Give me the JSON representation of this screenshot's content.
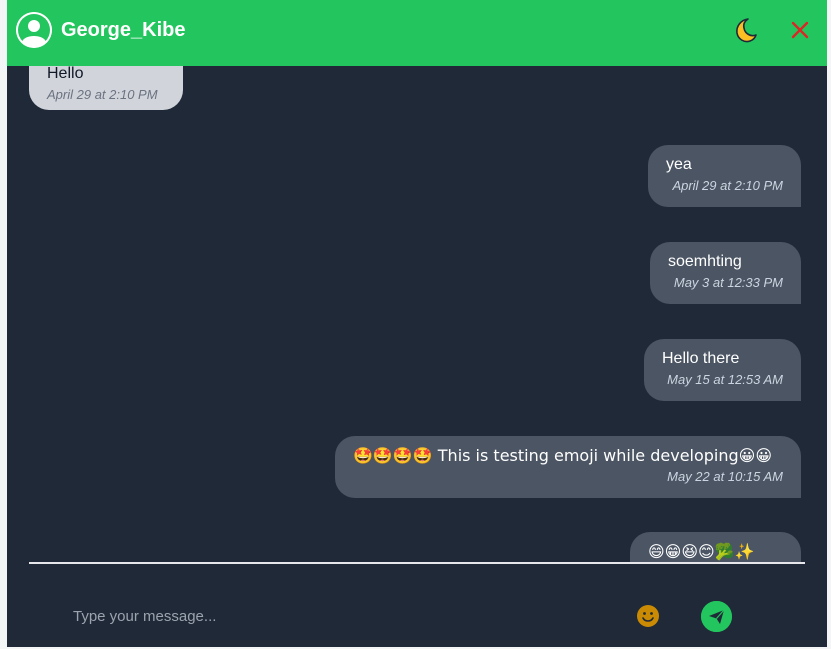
{
  "header": {
    "contact_name": "George_Kibe",
    "avatar_icon": "user-avatar-icon",
    "theme_toggle_icon": "moon-icon",
    "close_icon": "close-icon",
    "brand_color": "#22c55e"
  },
  "messages": [
    {
      "direction": "incoming",
      "text": "Hello",
      "time": "April 29 at 2:10 PM"
    },
    {
      "direction": "outgoing",
      "text": "yea",
      "time": "April 29 at 2:10 PM"
    },
    {
      "direction": "outgoing",
      "text": "soemhting",
      "time": "May 3 at 12:33 PM"
    },
    {
      "direction": "outgoing",
      "text": "Hello there",
      "time": "May 15 at 12:53 AM"
    },
    {
      "direction": "outgoing",
      "text": "🤩🤩🤩🤩 This is testing emoji while developing😀😀",
      "time": "May 22 at 10:15 AM"
    },
    {
      "direction": "outgoing",
      "text": "😄😁😆😊🥦✨",
      "time": ""
    }
  ],
  "composer": {
    "placeholder": "Type your message...",
    "value": "",
    "emoji_icon": "emoji-smiley-icon",
    "send_icon": "send-icon"
  },
  "colors": {
    "background": "#1f2937",
    "incoming_bubble": "#d1d5db",
    "outgoing_bubble": "#4b5563"
  }
}
